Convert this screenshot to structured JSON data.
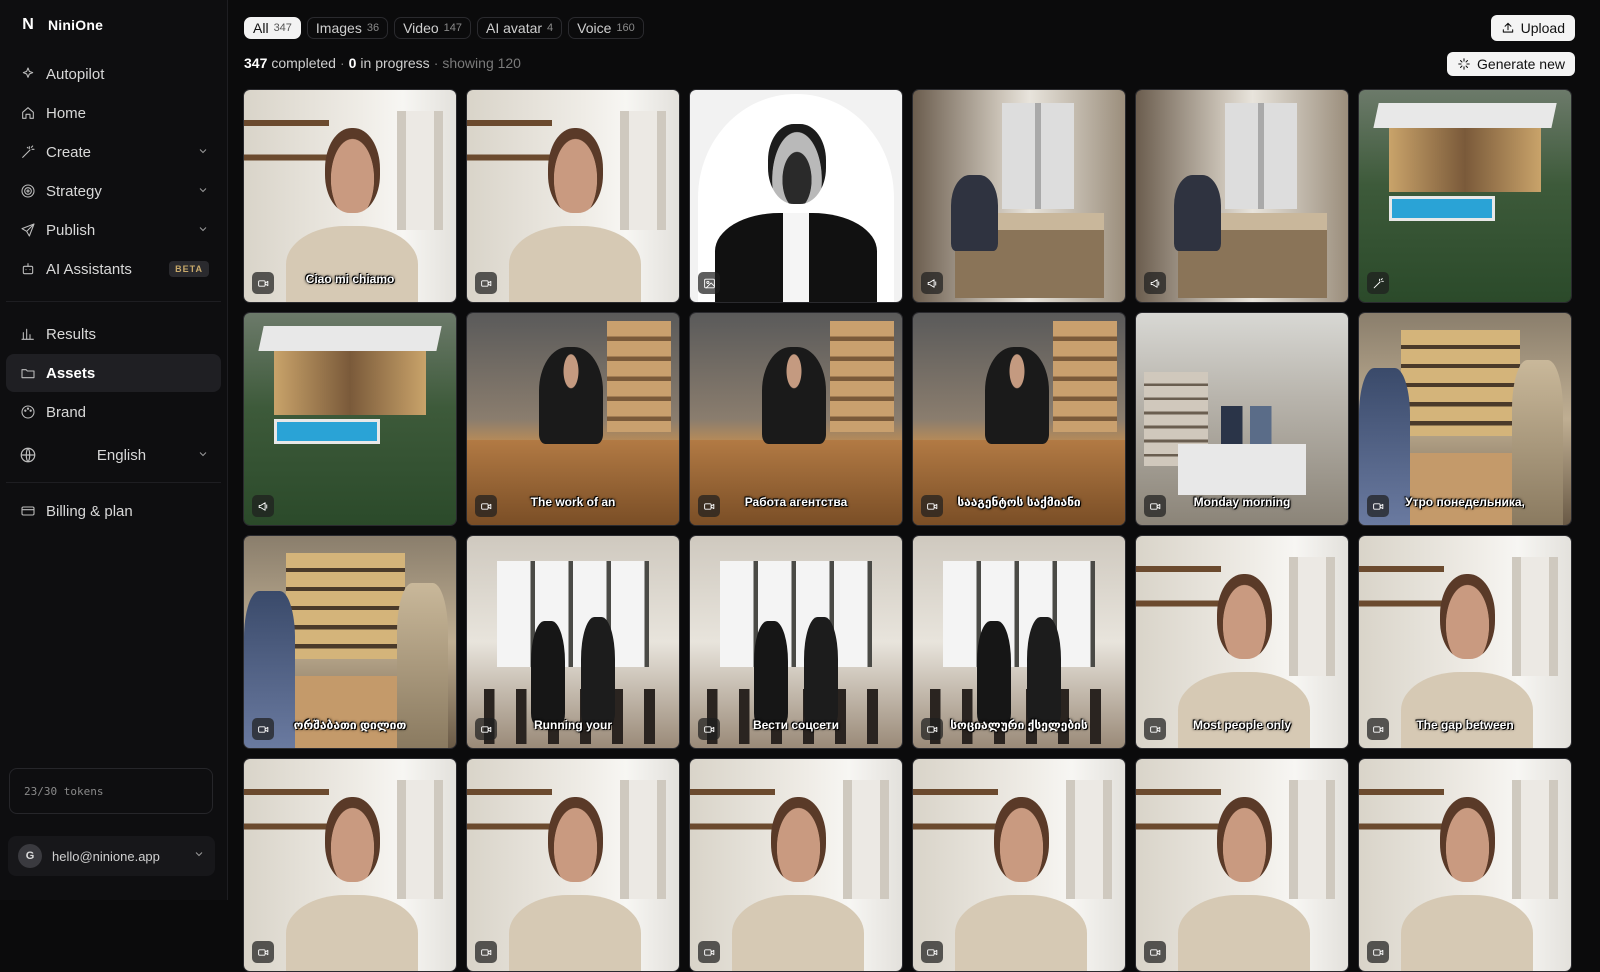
{
  "brand": {
    "name": "NiniOne",
    "mark": "N"
  },
  "nav": [
    {
      "label": "Autopilot",
      "icon": "sparkle-icon",
      "chevron": false
    },
    {
      "label": "Home",
      "icon": "home-icon",
      "chevron": false
    },
    {
      "label": "Create",
      "icon": "magic-wand-icon",
      "chevron": true
    },
    {
      "label": "Strategy",
      "icon": "target-icon",
      "chevron": true
    },
    {
      "label": "Publish",
      "icon": "send-icon",
      "chevron": true
    },
    {
      "label": "AI Assistants",
      "icon": "robot-icon",
      "chevron": false,
      "badge": "BETA"
    }
  ],
  "nav2": [
    {
      "label": "Results",
      "icon": "bar-chart-icon"
    },
    {
      "label": "Assets",
      "icon": "folder-icon",
      "active": true
    },
    {
      "label": "Brand",
      "icon": "palette-icon"
    }
  ],
  "language": {
    "label": "English"
  },
  "billing": {
    "label": "Billing & plan"
  },
  "tokens": {
    "text": "23/30 tokens"
  },
  "user": {
    "initial": "G",
    "email": "hello@ninione.app"
  },
  "filters": [
    {
      "label": "All",
      "count": "347",
      "active": true
    },
    {
      "label": "Images",
      "count": "36"
    },
    {
      "label": "Video",
      "count": "147"
    },
    {
      "label": "AI avatar",
      "count": "4"
    },
    {
      "label": "Voice",
      "count": "160"
    }
  ],
  "status": {
    "completed": "347",
    "completed_label": "completed",
    "sep": "·",
    "in_progress": "0",
    "in_progress_label": "in progress",
    "showing": "showing 120"
  },
  "actions": {
    "upload": "Upload",
    "generate": "Generate new"
  },
  "tiles": [
    {
      "thumb": "woman",
      "type": "video-icon",
      "caption": "Ciao mi chiamo"
    },
    {
      "thumb": "woman",
      "type": "video-icon",
      "caption": ""
    },
    {
      "thumb": "portrait",
      "type": "image-icon",
      "caption": ""
    },
    {
      "thumb": "office",
      "type": "megaphone-icon",
      "caption": ""
    },
    {
      "thumb": "office",
      "type": "megaphone-icon",
      "caption": ""
    },
    {
      "thumb": "house",
      "type": "wand-icon",
      "caption": ""
    },
    {
      "thumb": "house",
      "type": "megaphone-icon",
      "caption": ""
    },
    {
      "thumb": "agency",
      "type": "video-icon",
      "caption": "The work of an"
    },
    {
      "thumb": "agency",
      "type": "video-icon",
      "caption": "Работа агентства"
    },
    {
      "thumb": "agency",
      "type": "video-icon",
      "caption": "სააგენტოს საქმიანი"
    },
    {
      "thumb": "store",
      "type": "video-icon",
      "caption": "Monday morning"
    },
    {
      "thumb": "shop",
      "type": "video-icon",
      "caption": "Утро понедельника,"
    },
    {
      "thumb": "shop",
      "type": "video-icon",
      "caption": "ორშაბათი დილით"
    },
    {
      "thumb": "cafe",
      "type": "video-icon",
      "caption": "Running your"
    },
    {
      "thumb": "cafe",
      "type": "video-icon",
      "caption": "Вести соцсети"
    },
    {
      "thumb": "cafe",
      "type": "video-icon",
      "caption": "სოციალური ქსელების"
    },
    {
      "thumb": "woman",
      "type": "video-icon",
      "caption": "Most people only"
    },
    {
      "thumb": "woman",
      "type": "video-icon",
      "caption": "The gap between"
    },
    {
      "thumb": "woman",
      "type": "video-icon",
      "caption": ""
    },
    {
      "thumb": "woman",
      "type": "video-icon",
      "caption": ""
    },
    {
      "thumb": "woman",
      "type": "video-icon",
      "caption": ""
    },
    {
      "thumb": "woman",
      "type": "video-icon",
      "caption": ""
    },
    {
      "thumb": "woman",
      "type": "video-icon",
      "caption": ""
    },
    {
      "thumb": "woman",
      "type": "video-icon",
      "caption": ""
    }
  ]
}
